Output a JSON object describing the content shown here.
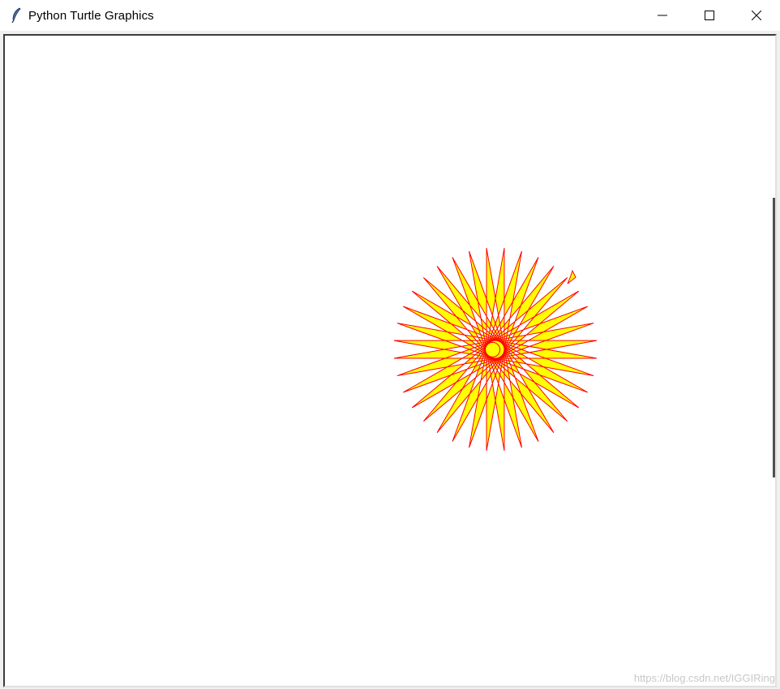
{
  "window": {
    "title": "Python Turtle Graphics",
    "icon": "feather-icon",
    "controls": [
      "minimize-icon",
      "maximize-icon",
      "close-icon"
    ]
  },
  "drawing": {
    "pen_color": "#ff0000",
    "fill_color": "#ffff00",
    "shape": "star",
    "turtle_icon": "turtle-arrow-icon"
  },
  "watermark": {
    "text": "https://blog.csdn.net/IGGIRing"
  }
}
